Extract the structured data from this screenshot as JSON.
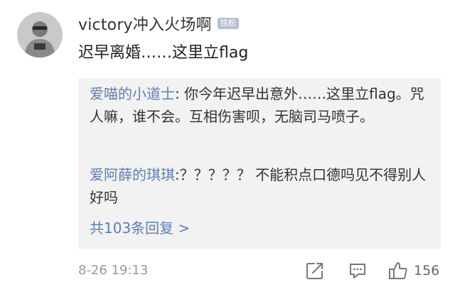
{
  "comment": {
    "username": "victory冲入火场啊",
    "badge": "铁粉",
    "text": "迟早离婚……这里立flag"
  },
  "replies": [
    {
      "author": "爱喵的小道士",
      "separator": ": ",
      "text": "你今年迟早出意外……这里立flag。咒人嘛，谁不会。互相伤害呗，无脑司马喷子。"
    },
    {
      "author": "爱阿薛的琪琪",
      "separator": ":",
      "text": "？？？？？ 不能积点口德吗见不得别人好吗"
    }
  ],
  "reply_count_text": "共103条回复 >",
  "footer": {
    "timestamp": "8-26 19:13",
    "like_count": "156"
  },
  "icons": {
    "share": "share-icon",
    "comment": "comment-icon",
    "like": "thumbs-up-icon"
  },
  "colors": {
    "link_blue": "#5b7fb6",
    "badge_bg": "#b5bfcf",
    "reply_bg": "#f2f2f2",
    "meta_gray": "#999999"
  }
}
